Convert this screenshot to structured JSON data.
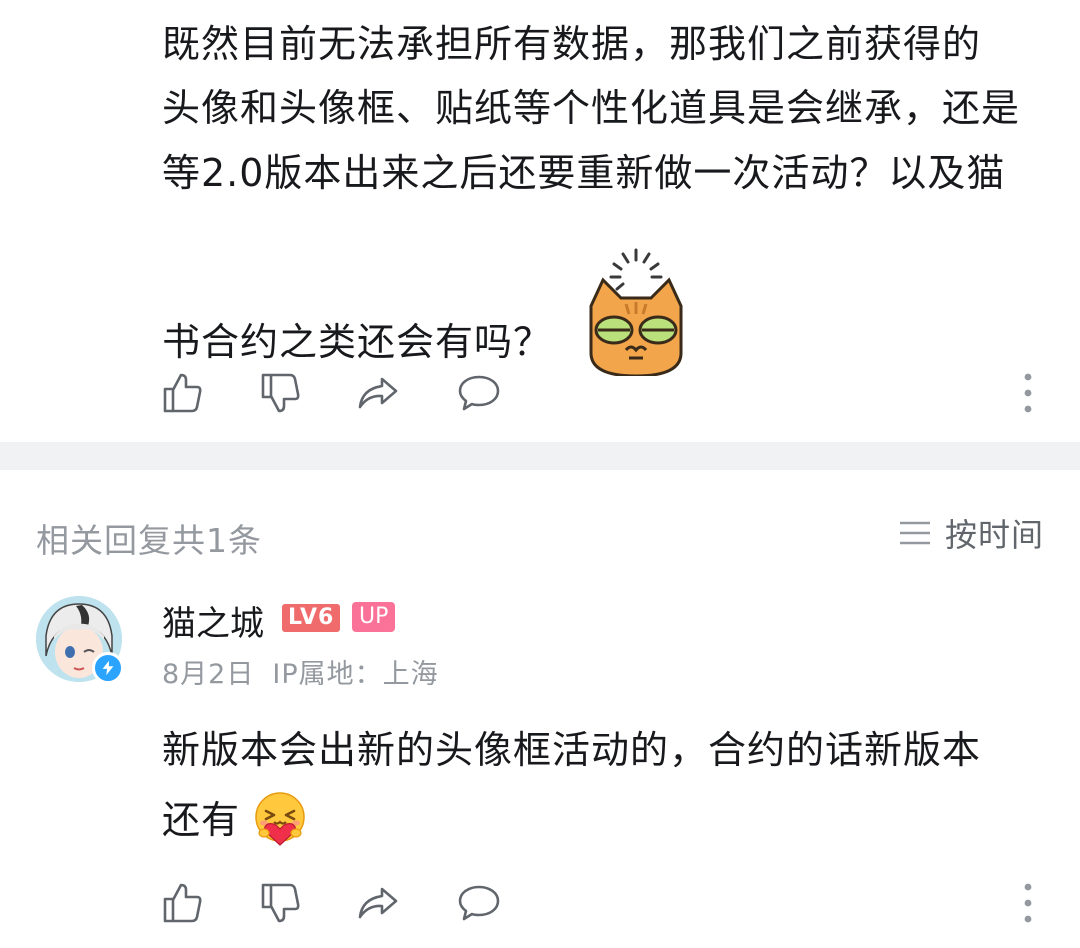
{
  "main_comment": {
    "lines": [
      "既然目前无法承担所有数据，那我们之前获得的",
      "头像和头像框、贴纸等个性化道具是会继承，还是",
      "等2.0版本出来之后还要重新做一次活动？以及猫",
      "书合约之类还会有吗？"
    ],
    "sticker": "loading-cat-sticker"
  },
  "actions": {
    "like_icon": "thumbs-up-icon",
    "dislike_icon": "thumbs-down-icon",
    "share_icon": "share-icon",
    "reply_icon": "comment-bubble-icon",
    "more_icon": "more-vertical-icon"
  },
  "replies_header": {
    "count_label": "相关回复共1条",
    "sort_label": "按时间",
    "sort_icon": "sort-lines-icon"
  },
  "reply": {
    "username": "猫之城",
    "level_badge": "LV6",
    "up_badge": "UP",
    "date": "8月2日",
    "ip": "IP属地：上海",
    "lines": [
      "新版本会出新的头像框活动的，合约的话新版本",
      "还有"
    ],
    "emoji": "hugging-heart-emoji",
    "avatar_badge_icon": "lightning-icon"
  },
  "colors": {
    "text_primary": "#18191c",
    "text_secondary": "#9499a0",
    "level_badge": "#f06b6b",
    "up_badge": "#fb7299",
    "divider": "#f1f2f3",
    "verify_badge": "#2aa4ff"
  }
}
